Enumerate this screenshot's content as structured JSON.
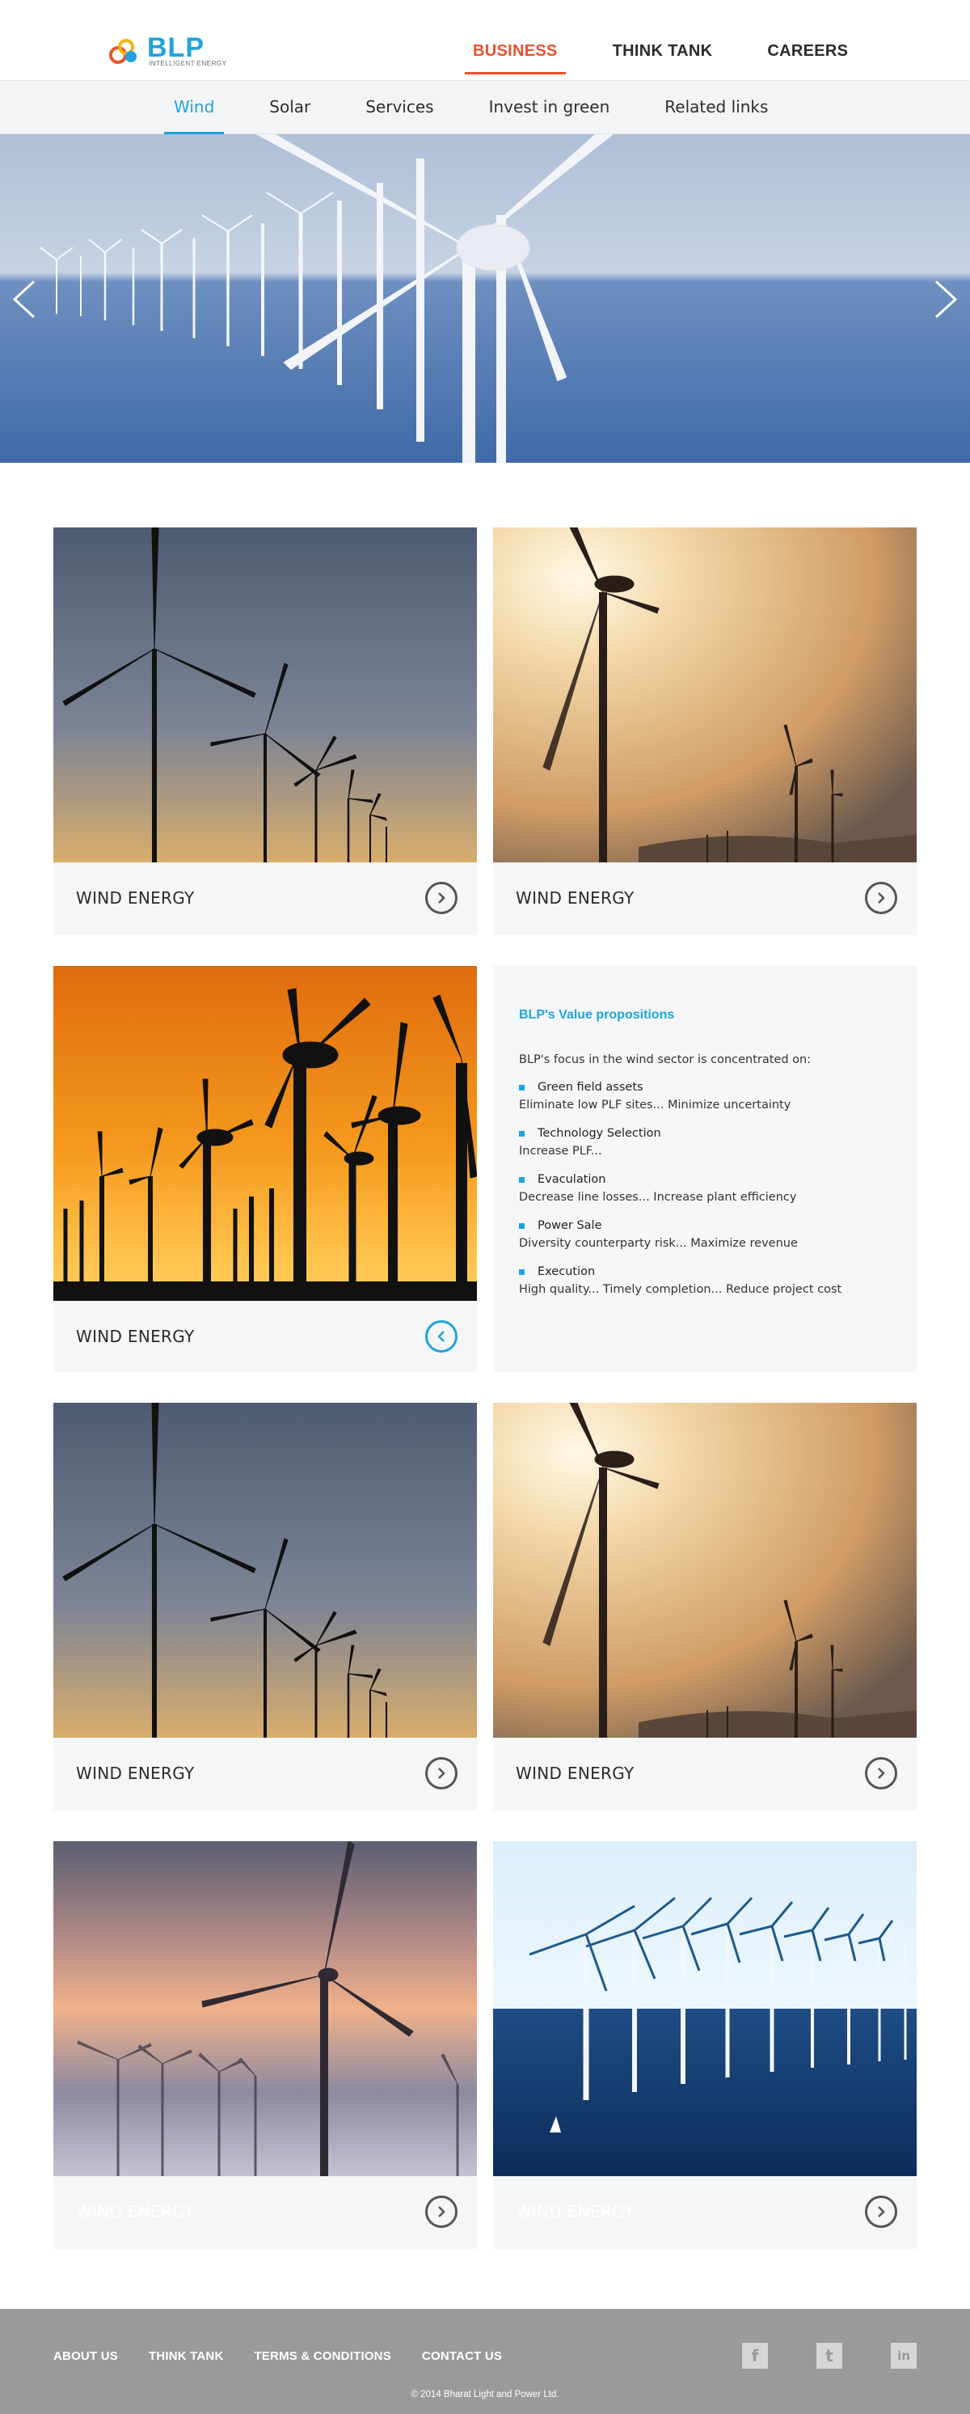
{
  "brand": {
    "name": "BLP",
    "tagline": "INTELLIGENT ENERGY",
    "colors": {
      "accent": "#1fa3dc",
      "active_nav": "#e8522c",
      "footer_bg": "#9a9a9a"
    }
  },
  "topnav": {
    "items": [
      "BUSINESS",
      "THINK TANK",
      "CAREERS"
    ],
    "active": "BUSINESS"
  },
  "subnav": {
    "items": [
      "Wind",
      "Solar",
      "Services",
      "Invest in green",
      "Related links"
    ],
    "active": "Wind"
  },
  "hero": {
    "prev_icon": "chevron-left-icon",
    "next_icon": "chevron-right-icon"
  },
  "cards": [
    {
      "label": "WIND ENERGY"
    },
    {
      "label": "WIND ENERGY"
    },
    {
      "label": "WIND ENERGY"
    },
    {
      "label": "WIND ENERGY"
    },
    {
      "label": "WIND ENERGY"
    },
    {
      "label": "WIND ENERGY"
    },
    {
      "label": "WIND ENERGY"
    }
  ],
  "value_props": {
    "title": "BLP's Value propositions",
    "intro": "BLP's focus in the wind sector is concentrated on:",
    "items": [
      {
        "title": "Green field assets",
        "desc": "Eliminate low PLF sites... Minimize uncertainty"
      },
      {
        "title": "Technology Selection",
        "desc": "Increase PLF..."
      },
      {
        "title": "Evaculation",
        "desc": "Decrease line losses... Increase plant efficiency"
      },
      {
        "title": "Power Sale",
        "desc": "Diversity counterparty risk... Maximize revenue"
      },
      {
        "title": "Execution",
        "desc": "High quality... Timely completion... Reduce project cost"
      }
    ]
  },
  "footer": {
    "links": [
      "ABOUT US",
      "THINK TANK",
      "TERMS & CONDITIONS",
      "CONTACT US"
    ],
    "social": [
      "f",
      "t",
      "in"
    ],
    "copyright": "© 2014 Bharat Light and Power Ltd."
  }
}
